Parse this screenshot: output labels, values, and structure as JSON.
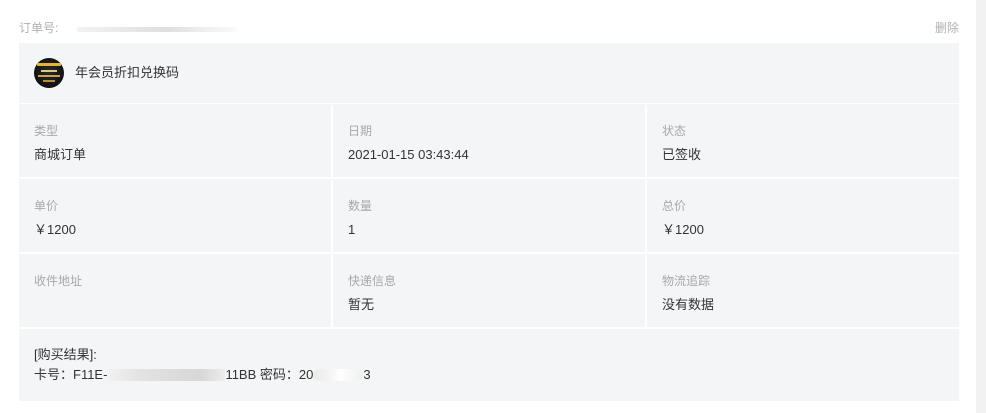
{
  "order": {
    "label": "订单号:",
    "delete_label": "删除"
  },
  "product": {
    "name": "年会员折扣兑换码",
    "thumb_icon": "product-thumbnail"
  },
  "details": [
    {
      "label": "类型",
      "value": "商城订单"
    },
    {
      "label": "日期",
      "value": "2021-01-15 03:43:44"
    },
    {
      "label": "状态",
      "value": "已签收"
    },
    {
      "label": "单价",
      "value": "￥1200"
    },
    {
      "label": "数量",
      "value": "1"
    },
    {
      "label": "总价",
      "value": "￥1200"
    },
    {
      "label": "收件地址",
      "value": ""
    },
    {
      "label": "快递信息",
      "value": "暂无"
    },
    {
      "label": "物流追踪",
      "value": "没有数据"
    }
  ],
  "result": {
    "title": "[购买结果]:",
    "card_prefix": "卡号：F11E-",
    "card_suffix": "11BB 密码：20",
    "password_suffix": "3"
  },
  "colors": {
    "card_bg": "#f4f5f7",
    "muted_text": "#b0b0b0",
    "body_text": "#333333"
  }
}
